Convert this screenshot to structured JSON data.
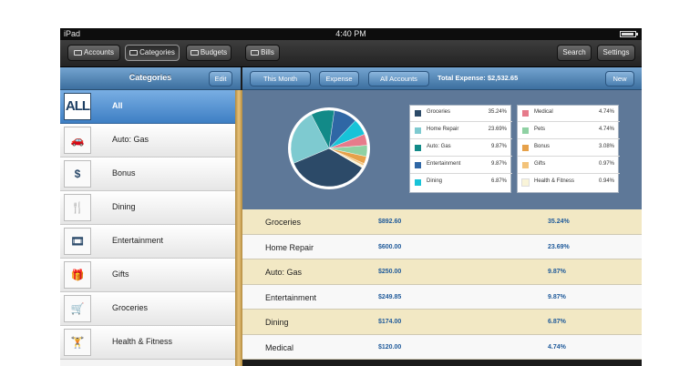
{
  "statusbar": {
    "carrier": "iPad",
    "time": "4:40 PM"
  },
  "toolbar": {
    "accounts_label": "Accounts",
    "categories_label": "Categories",
    "budgets_label": "Budgets",
    "bills_label": "Bills",
    "search_label": "Search",
    "settings_label": "Settings"
  },
  "left_panel": {
    "title": "Categories",
    "edit_label": "Edit",
    "items": [
      {
        "label": "All",
        "icon": "all-icon",
        "icon_text": "ALL"
      },
      {
        "label": "Auto: Gas",
        "icon": "car-icon",
        "icon_text": "🚗"
      },
      {
        "label": "Bonus",
        "icon": "cash-icon",
        "icon_text": "$"
      },
      {
        "label": "Dining",
        "icon": "fork-knife-icon",
        "icon_text": "🍴"
      },
      {
        "label": "Entertainment",
        "icon": "film-reel-icon",
        "icon_text": "🎞"
      },
      {
        "label": "Gifts",
        "icon": "gift-icon",
        "icon_text": "🎁"
      },
      {
        "label": "Groceries",
        "icon": "cart-icon",
        "icon_text": "🛒"
      },
      {
        "label": "Health & Fitness",
        "icon": "dumbbell-icon",
        "icon_text": "🏋"
      }
    ]
  },
  "filters": {
    "period_label": "This Month",
    "type_label": "Expense",
    "accounts_label": "All Accounts",
    "total_text": "Total Expense: $2,532.65",
    "new_label": "New"
  },
  "chart_data": {
    "type": "pie",
    "labels": [
      "Groceries",
      "Home Repair",
      "Auto: Gas",
      "Entertainment",
      "Dining",
      "Medical",
      "Pets",
      "Bonus",
      "Gifts",
      "Health & Fitness"
    ],
    "values": [
      35.24,
      23.69,
      9.87,
      9.87,
      6.87,
      4.74,
      4.74,
      3.08,
      0.97,
      0.94
    ],
    "value_labels": [
      "35.24%",
      "23.69%",
      "9.87%",
      "9.87%",
      "6.87%",
      "4.74%",
      "4.74%",
      "3.08%",
      "0.97%",
      "0.94%"
    ],
    "colors": [
      "#2c4a68",
      "#7ecad0",
      "#128a88",
      "#2f67a5",
      "#18c3d8",
      "#e67b8b",
      "#8fd1a3",
      "#e6a14a",
      "#f3c37a",
      "#f9f4d8"
    ]
  },
  "table": {
    "rows": [
      {
        "name": "Groceries",
        "amount": "$892.60",
        "percent": "35.24%"
      },
      {
        "name": "Home Repair",
        "amount": "$600.00",
        "percent": "23.69%"
      },
      {
        "name": "Auto: Gas",
        "amount": "$250.00",
        "percent": "9.87%"
      },
      {
        "name": "Entertainment",
        "amount": "$249.85",
        "percent": "9.87%"
      },
      {
        "name": "Dining",
        "amount": "$174.00",
        "percent": "6.87%"
      },
      {
        "name": "Medical",
        "amount": "$120.00",
        "percent": "4.74%"
      }
    ]
  }
}
